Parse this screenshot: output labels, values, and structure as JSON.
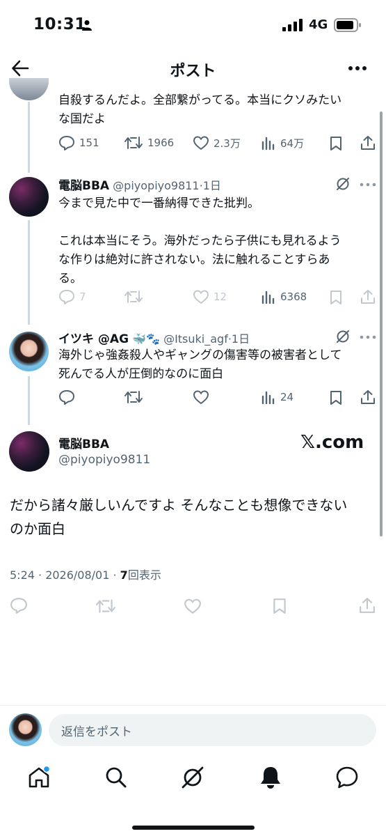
{
  "status_bar": {
    "time": "10:31",
    "network": "4G"
  },
  "header": {
    "title": "ポスト"
  },
  "posts": [
    {
      "text": "自殺するんだよ。全部繋がってる。本当にクソみたいな国だよ",
      "line1": "自殺するんだよ。全部繋がってる。本当にクソみたい",
      "line2": "な国だよ",
      "replies": "151",
      "reposts": "1966",
      "likes": "2.3万",
      "views": "64万"
    },
    {
      "name": "電脳BBA",
      "handle": "@piyopiyo9811",
      "time": "·1日",
      "lines": [
        "今まで見た中で一番納得できた批判。",
        "",
        "これは本当にそう。海外だったら子供にも見れるよう",
        "な作りは絶対に許されない。法に触れることすらあ",
        "る。"
      ],
      "replies": "7",
      "reposts": "",
      "likes": "12",
      "views": "6368"
    },
    {
      "name": "イツキ @AG",
      "name_emoji": "🐳🐾",
      "handle": "@Itsuki_agf",
      "time": "·1日",
      "lines": [
        "海外じゃ強姦殺人やギャングの傷害等の被害者として",
        "死んでる人が圧倒的なのに面白"
      ],
      "views": "24"
    }
  ],
  "main_post": {
    "name": "電脳BBA",
    "handle": "@piyopiyo9811",
    "watermark": "𝕏.com",
    "line1": "だから諸々厳しいんですよ そんなことも想像できない",
    "line2": "のか面白",
    "timestamp": "5:24 · 2026/08/01 · ",
    "view_count": "7",
    "view_label": "回表示"
  },
  "reply_box": {
    "placeholder": "返信をポスト"
  },
  "colors": {
    "text": "#0f1419",
    "secondary": "#536471",
    "accent": "#1d9bf0",
    "thread_line": "#cfd9de"
  },
  "icons": [
    "back-arrow-icon",
    "more-icon",
    "reply-icon",
    "repost-icon",
    "like-icon",
    "views-icon",
    "bookmark-icon",
    "share-icon",
    "grok-icon",
    "home-icon",
    "search-icon",
    "notifications-icon",
    "messages-icon"
  ]
}
